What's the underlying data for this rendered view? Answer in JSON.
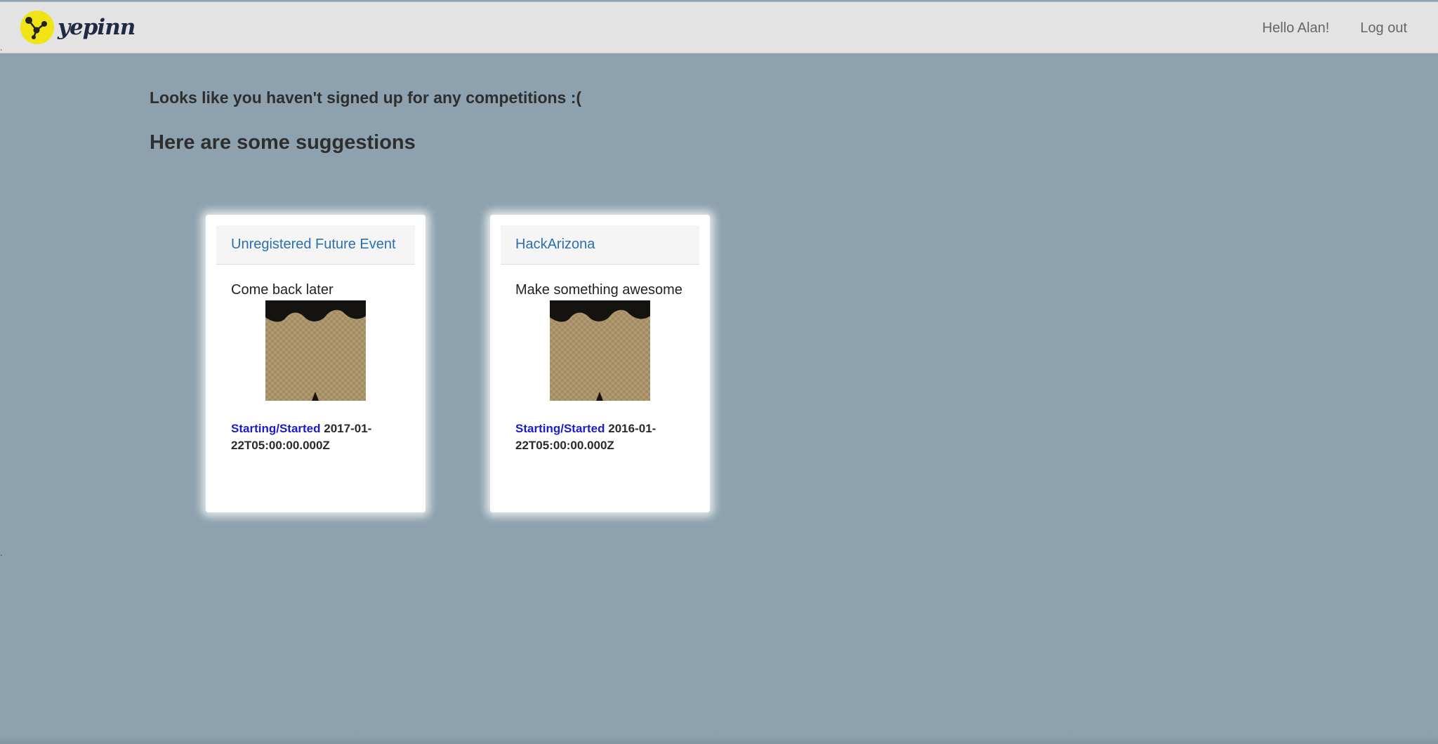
{
  "navbar": {
    "brand": "yepinn",
    "greeting": "Hello Alan!",
    "logout_label": "Log out",
    "logo_icon": "yepinn-molecule-logo",
    "logo_color": "#f0e416"
  },
  "messages": {
    "empty": "Looks like you haven't signed up for any competitions :(",
    "suggestions_heading": "Here are some suggestions"
  },
  "cards": [
    {
      "title": "Unregistered Future Event",
      "description": "Come back later",
      "image_icon": "event-thumbnail",
      "status_label": "Starting/Started",
      "date": "2017-01-22T05:00:00.000Z"
    },
    {
      "title": "HackArizona",
      "description": "Make something awesome",
      "image_icon": "event-thumbnail",
      "status_label": "Starting/Started",
      "date": "2016-01-22T05:00:00.000Z"
    }
  ],
  "colors": {
    "background": "#8da2ae",
    "navbar": "#e3e3e3",
    "title_link": "#2a6fae",
    "status_label": "#1b1bcf"
  }
}
